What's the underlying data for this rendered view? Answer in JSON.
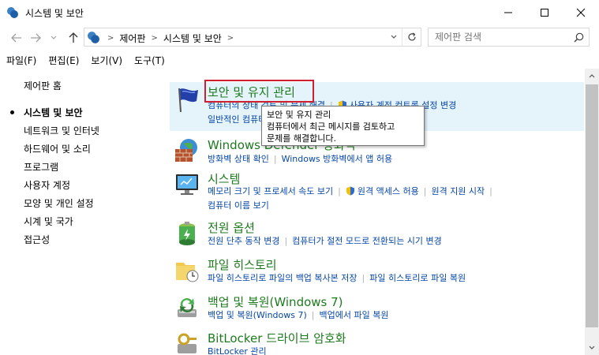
{
  "window": {
    "title": "시스템 및 보안",
    "minimize": "—",
    "maximize": "☐",
    "close": "✕"
  },
  "address": {
    "crumbs": [
      "제어판",
      "시스템 및 보안"
    ],
    "search_placeholder": "제어판 검색"
  },
  "menu": [
    "파일(F)",
    "편집(E)",
    "보기(V)",
    "도구(T)"
  ],
  "sidebar": {
    "home": "제어판 홈",
    "items": [
      "시스템 및 보안",
      "네트워크 및 인터넷",
      "하드웨어 및 소리",
      "프로그램",
      "사용자 계정",
      "모양 및 개인 설정",
      "시계 및 국가",
      "접근성"
    ]
  },
  "categories": [
    {
      "title": "보안 및 유지 관리",
      "links": [
        "컴퓨터의 상태 검토 및 문제 해결",
        "사용자 계정 컨트롤 설정 변경",
        "일반적인 컴퓨터 문제 해결"
      ]
    },
    {
      "title": "Windows Defender 방화벽",
      "links": [
        "방화벽 상태 확인",
        "Windows 방화벽에서 앱 허용"
      ]
    },
    {
      "title": "시스템",
      "links": [
        "메모리 크기 및 프로세서 속도 보기",
        "원격 액세스 허용",
        "원격 지원 시작",
        "컴퓨터 이름 보기"
      ]
    },
    {
      "title": "전원 옵션",
      "links": [
        "전원 단추 동작 변경",
        "컴퓨터가 절전 모드로 전환되는 시기 변경"
      ]
    },
    {
      "title": "파일 히스토리",
      "links": [
        "파일 히스토리로 파일의 백업 복사본 저장",
        "파일 히스토리로 파일 복원"
      ]
    },
    {
      "title": "백업 및 복원(Windows 7)",
      "links": [
        "백업 및 복원(Windows 7)",
        "백업에서 파일 복원"
      ]
    },
    {
      "title": "BitLocker 드라이브 암호화",
      "links": [
        "BitLocker 관리"
      ]
    }
  ],
  "tooltip": {
    "line1": "보안 및 유지 관리",
    "line2": "컴퓨터에서 최근 메시지를 검토하고",
    "line3": "문제를 해결합니다."
  },
  "colors": {
    "category_title": "#1e7a1e",
    "link": "#0646a6",
    "highlight": "#e5f3fb",
    "focus_border": "#d02030"
  }
}
